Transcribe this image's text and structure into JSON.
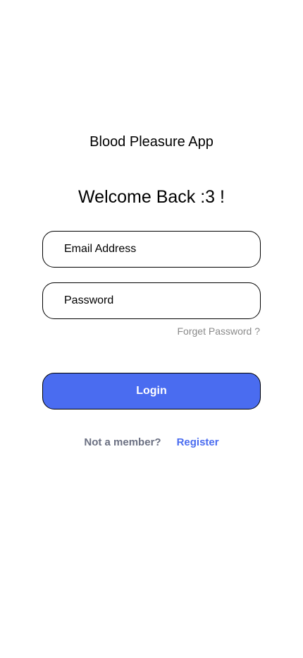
{
  "app": {
    "title": "Blood Pleasure App"
  },
  "login": {
    "heading": "Welcome Back :3 !",
    "email_placeholder": "Email Address",
    "password_placeholder": "Password",
    "forgot_label": "Forget Password ?",
    "login_label": "Login",
    "not_member_label": "Not a member?",
    "register_label": "Register"
  },
  "colors": {
    "primary": "#4a6cf0",
    "muted_text": "#8a8a8a",
    "secondary_text": "#6b7082",
    "border": "#000000",
    "background": "#ffffff"
  }
}
